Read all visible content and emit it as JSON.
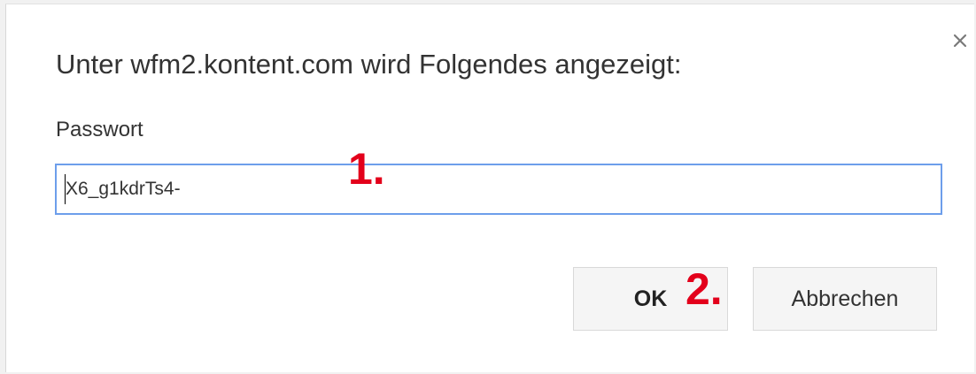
{
  "dialog": {
    "title": "Unter wfm2.kontent.com wird Folgendes angezeigt:",
    "close_icon": "close-icon",
    "field_label": "Passwort",
    "input_value": "X6_g1kdrTs4-",
    "ok_label": "OK",
    "cancel_label": "Abbrechen"
  },
  "annotations": {
    "step1": "1.",
    "step2": "2."
  },
  "colors": {
    "focus_border": "#6d9eeb",
    "annotation_red": "#e3001b",
    "button_bg": "#f5f5f5"
  }
}
